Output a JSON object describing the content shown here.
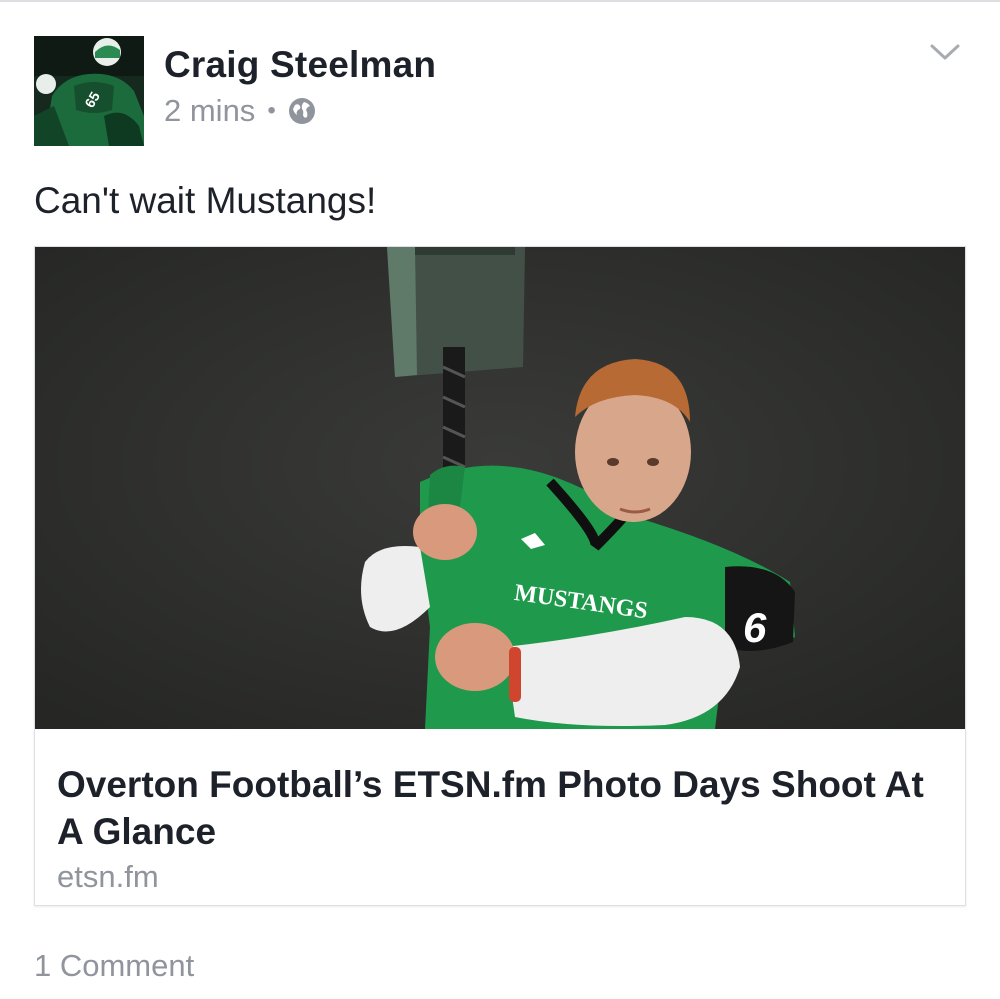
{
  "post": {
    "author": "Craig Steelman",
    "time": "2 mins",
    "separator": "•",
    "privacy_icon": "globe-icon",
    "text": "Can't wait Mustangs!",
    "menu_icon": "chevron-down-icon"
  },
  "link": {
    "title": "Overton Football’s ETSN.fm Photo Days Shoot At A Glance",
    "domain": "etsn.fm"
  },
  "footer": {
    "comments": "1 Comment"
  },
  "colors": {
    "name_text": "#1d2129",
    "meta_text": "#90949c",
    "jersey_green": "#1f9a4d",
    "border": "#dddfe2"
  }
}
